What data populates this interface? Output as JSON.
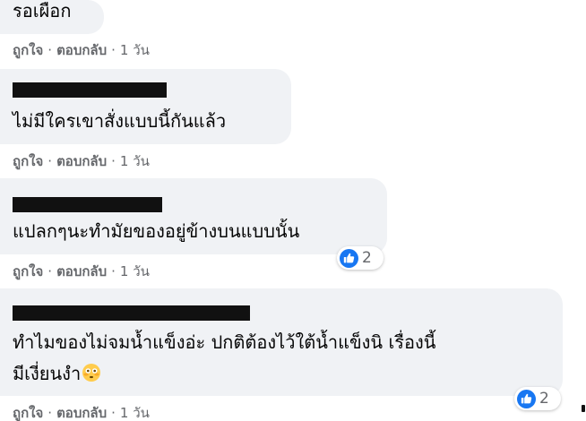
{
  "comments": [
    {
      "text": "รอเผือก",
      "actions": {
        "like": "ถูกใจ",
        "reply": "ตอบกลับ",
        "time": "1 วัน"
      }
    },
    {
      "author_redacted": true,
      "text": "ไม่มีใครเขาสั่งแบบนี้กันแล้ว",
      "actions": {
        "like": "ถูกใจ",
        "reply": "ตอบกลับ",
        "time": "1 วัน"
      }
    },
    {
      "author_redacted": true,
      "text": "แปลกๆนะทำมัยของอยู่ข้างบนแบบนั้น",
      "actions": {
        "like": "ถูกใจ",
        "reply": "ตอบกลับ",
        "time": "1 วัน"
      },
      "reaction": {
        "icon": "like-icon",
        "count": "2"
      }
    },
    {
      "author_redacted": true,
      "text_line1": "ทำไมของไม่จมน้ำแข็งอ่ะ ปกติต้องไว้ใต้น้ำแข็งนิ เรื่องนี้",
      "text_line2": "มีเงี่ยนงำ",
      "emoji": "flushed-face-icon",
      "actions": {
        "like": "ถูกใจ",
        "reply": "ตอบกลับ",
        "time": "1 วัน"
      },
      "reaction": {
        "icon": "like-icon",
        "count": "2"
      }
    }
  ],
  "separator": "·",
  "colors": {
    "bubble": "#f0f2f5",
    "meta_text": "#65676b",
    "like_blue": "#1877f2",
    "redaction": "#111111"
  }
}
